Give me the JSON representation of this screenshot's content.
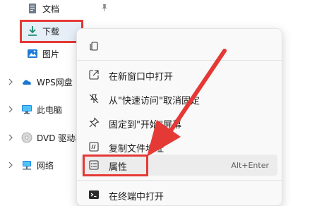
{
  "nav": {
    "items": [
      {
        "label": "文档",
        "icon": "document-icon"
      },
      {
        "label": "下载",
        "icon": "download-icon"
      },
      {
        "label": "图片",
        "icon": "pictures-icon"
      },
      {
        "label": "WPS网盘",
        "icon": "cloud-icon"
      },
      {
        "label": "此电脑",
        "icon": "computer-icon"
      },
      {
        "label": "DVD 驱动器",
        "icon": "dvd-icon"
      },
      {
        "label": "网络",
        "icon": "network-icon"
      }
    ]
  },
  "context_menu": {
    "items": [
      {
        "label": "在新窗口中打开",
        "icon": "open-new-window-icon"
      },
      {
        "label": "从\"快速访问\"取消固定",
        "icon": "unpin-icon"
      },
      {
        "label": "固定到\"开始\"屏幕",
        "icon": "pin-icon"
      },
      {
        "label": "复制文件地址",
        "icon": "copy-path-icon"
      },
      {
        "label": "属性",
        "icon": "properties-icon",
        "shortcut": "Alt+Enter"
      },
      {
        "label": "在终端中打开",
        "icon": "terminal-icon"
      }
    ]
  },
  "colors": {
    "highlight": "#e53935",
    "accent": "#0a7cd8"
  }
}
